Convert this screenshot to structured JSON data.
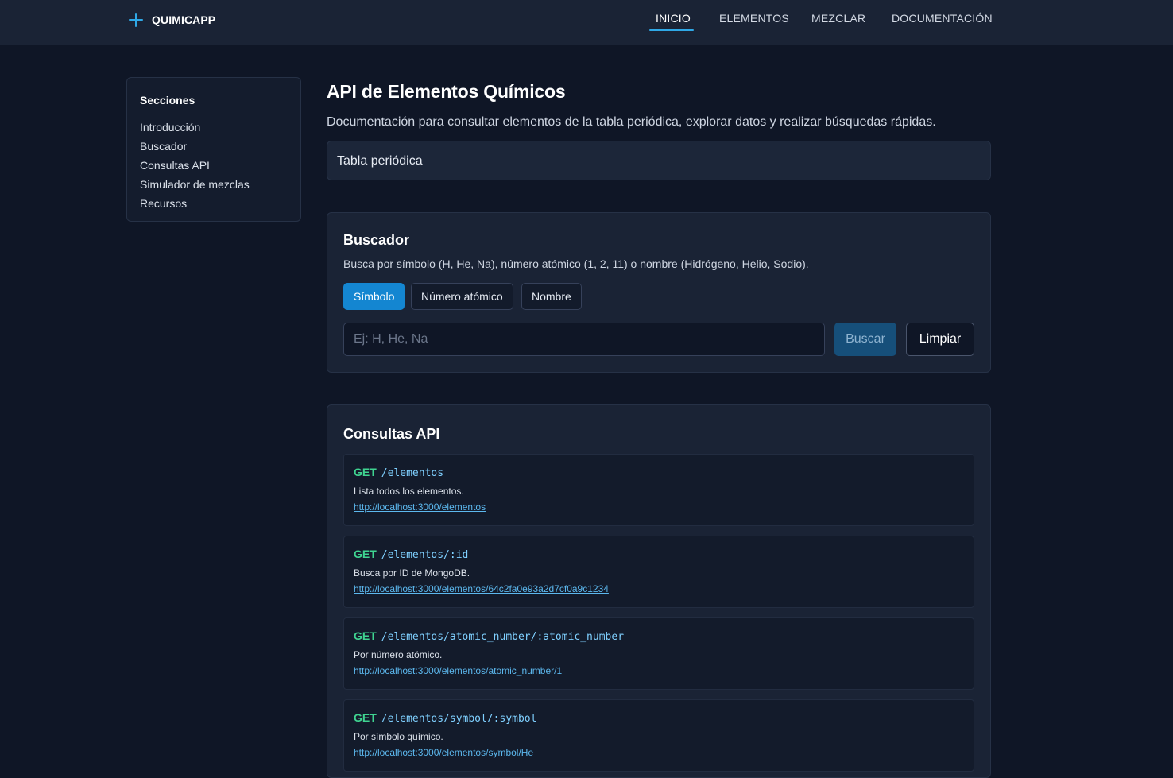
{
  "header": {
    "brand": "QUIMICAPP",
    "nav": [
      "INICIO",
      "ELEMENTOS",
      "MEZCLAR",
      "DOCUMENTACIÓN"
    ],
    "active_nav": "INICIO"
  },
  "sidebar": {
    "title": "Secciones",
    "items": [
      "Introducción",
      "Buscador",
      "Consultas API",
      "Simulador de mezclas",
      "Recursos"
    ]
  },
  "main": {
    "title": "API de Elementos Químicos",
    "description": "Documentación para consultar elementos de la tabla periódica, explorar datos y realizar búsquedas rápidas.",
    "periodic_table_label": "Tabla periódica"
  },
  "search": {
    "title": "Buscador",
    "hint": "Busca por símbolo (H, He, Na), número atómico (1, 2, 11) o nombre (Hidrógeno, Helio, Sodio).",
    "modes": [
      "Símbolo",
      "Número atómico",
      "Nombre"
    ],
    "active_mode": "Símbolo",
    "input_value": "",
    "placeholder": "Ej: H, He, Na",
    "search_label": "Buscar",
    "clear_label": "Limpiar"
  },
  "api": {
    "title": "Consultas API",
    "endpoints": [
      {
        "method": "GET",
        "path": "/elementos",
        "description": "Lista todos los elementos.",
        "url": "http://localhost:3000/elementos"
      },
      {
        "method": "GET",
        "path": "/elementos/:id",
        "description": "Busca por ID de MongoDB.",
        "url": "http://localhost:3000/elementos/64c2fa0e93a2d7cf0a9c1234"
      },
      {
        "method": "GET",
        "path": "/elementos/atomic_number/:atomic_number",
        "description": "Por número atómico.",
        "url": "http://localhost:3000/elementos/atomic_number/1"
      },
      {
        "method": "GET",
        "path": "/elementos/symbol/:symbol",
        "description": "Por símbolo químico.",
        "url": "http://localhost:3000/elementos/symbol/He"
      }
    ]
  },
  "colors": {
    "accent": "#2fa8e6",
    "primary_button": "#1486d1",
    "method_get": "#3fd491",
    "path": "#7fd0ff",
    "background": "#0f1626",
    "card": "#1a2335"
  }
}
